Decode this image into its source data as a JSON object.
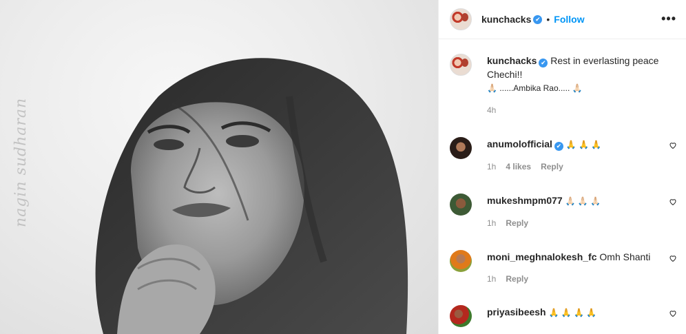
{
  "photo": {
    "watermark": "nagin sudharan"
  },
  "header": {
    "username": "kunchacks",
    "verified_icon": "✔",
    "separator": "•",
    "follow_label": "Follow",
    "more_icon": "•••"
  },
  "caption": {
    "username": "kunchacks",
    "text_line1": "Rest in everlasting peace",
    "text_line2": "Chechi!!",
    "text_line3": "🙏🏻 ......Ambika Rao..... 🙏🏻",
    "time": "4h"
  },
  "comments": [
    {
      "username": "anumolofficial",
      "text": "🙏 🙏 🙏",
      "time": "1h",
      "likes": "4 likes",
      "reply": "Reply"
    },
    {
      "username": "mukeshmpm077",
      "text": "🙏🏻 🙏🏻 🙏🏻",
      "time": "1h",
      "reply": "Reply"
    },
    {
      "username": "moni_meghnalokesh_fc",
      "text": "Omh Shanti",
      "time": "1h",
      "reply": "Reply"
    },
    {
      "username": "priyasibeesh",
      "text": "🙏 🙏 🙏 🙏"
    }
  ],
  "colors": {
    "follow": "#0095f6",
    "verified": "#3897f0",
    "meta": "#8e8e8e"
  }
}
